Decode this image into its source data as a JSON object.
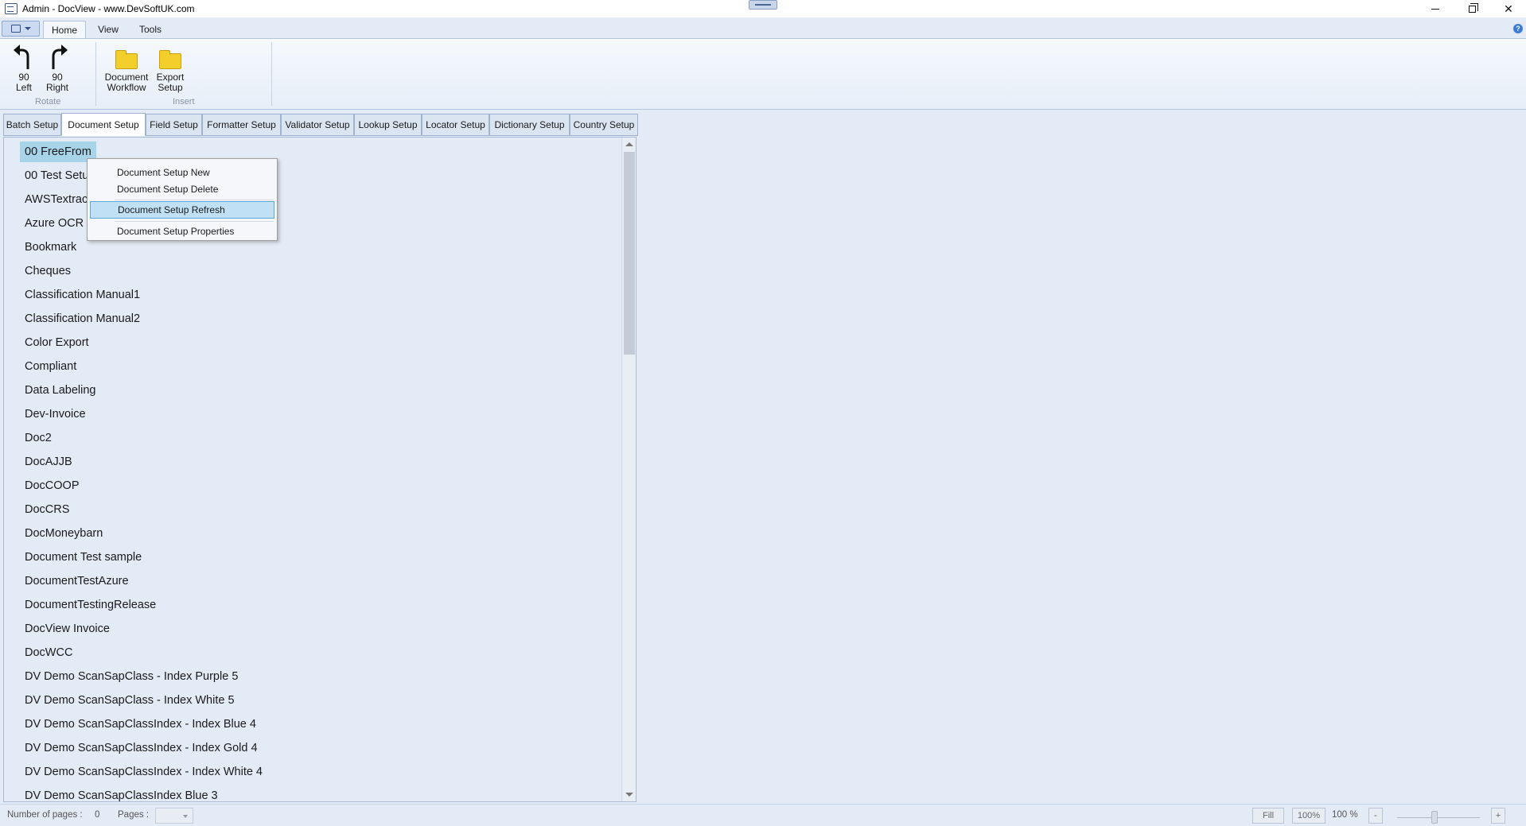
{
  "window": {
    "title": "Admin - DocView - www.DevSoftUK.com",
    "minimize_icon": "minimize-icon",
    "maximize_icon": "restore-icon",
    "close_glyph": "✕"
  },
  "ribbon": {
    "tabs": [
      {
        "label": "Home",
        "active": true
      },
      {
        "label": "View"
      },
      {
        "label": "Tools"
      }
    ],
    "help_glyph": "?",
    "groups": {
      "rotate": {
        "label": "Rotate",
        "buttons": [
          {
            "line1": "90",
            "line2": "Left",
            "icon": "rotate-left-icon"
          },
          {
            "line1": "90",
            "line2": "Right",
            "icon": "rotate-right-icon"
          }
        ]
      },
      "insert": {
        "label": "Insert",
        "buttons": [
          {
            "line1": "Document",
            "line2": "Workflow",
            "icon": "folder-icon"
          },
          {
            "line1": "Export",
            "line2": "Setup",
            "icon": "folder-icon"
          }
        ]
      }
    }
  },
  "setup_tabs": [
    {
      "label": "Batch Setup"
    },
    {
      "label": "Document Setup",
      "active": true
    },
    {
      "label": "Field Setup"
    },
    {
      "label": "Formatter Setup"
    },
    {
      "label": "Validator Setup"
    },
    {
      "label": "Lookup Setup"
    },
    {
      "label": "Locator Setup"
    },
    {
      "label": "Dictionary Setup"
    },
    {
      "label": "Country Setup"
    }
  ],
  "document_list": {
    "selected_index": 0,
    "items": [
      "00 FreeFrom",
      "00 Test Setu",
      "AWSTextrac",
      "Azure OCR T",
      "Bookmark",
      "Cheques",
      "Classification Manual1",
      "Classification Manual2",
      "Color Export",
      "Compliant",
      "Data Labeling",
      "Dev-Invoice",
      "Doc2",
      "DocAJJB",
      "DocCOOP",
      "DocCRS",
      "DocMoneybarn",
      "Document Test sample",
      "DocumentTestAzure",
      "DocumentTestingRelease",
      "DocView Invoice",
      "DocWCC",
      "DV Demo ScanSapClass - Index Purple 5",
      "DV Demo ScanSapClass - Index White 5",
      "DV Demo ScanSapClassIndex - Index  Blue 4",
      "DV Demo ScanSapClassIndex - Index  Gold 4",
      "DV Demo ScanSapClassIndex - Index  White 4",
      "DV Demo ScanSapClassIndex Blue 3"
    ]
  },
  "context_menu": {
    "items": [
      {
        "label": "Document Setup New"
      },
      {
        "label": "Document Setup Delete"
      },
      {
        "label": "Document Setup Refresh",
        "highlighted": true
      },
      {
        "label": "Document Setup Properties"
      }
    ]
  },
  "status_bar": {
    "num_pages_label": "Number of pages :",
    "num_pages_value": "0",
    "pages_label": "Pages :",
    "fill_label": "Fill",
    "hundred_label": "100%",
    "zoom_value": "100 %",
    "zoom_out": "-",
    "zoom_in": "+"
  },
  "colors": {
    "background": "#e3ebf6",
    "selection": "#a8d4ea",
    "menu_highlight": "#bfe0f5"
  }
}
